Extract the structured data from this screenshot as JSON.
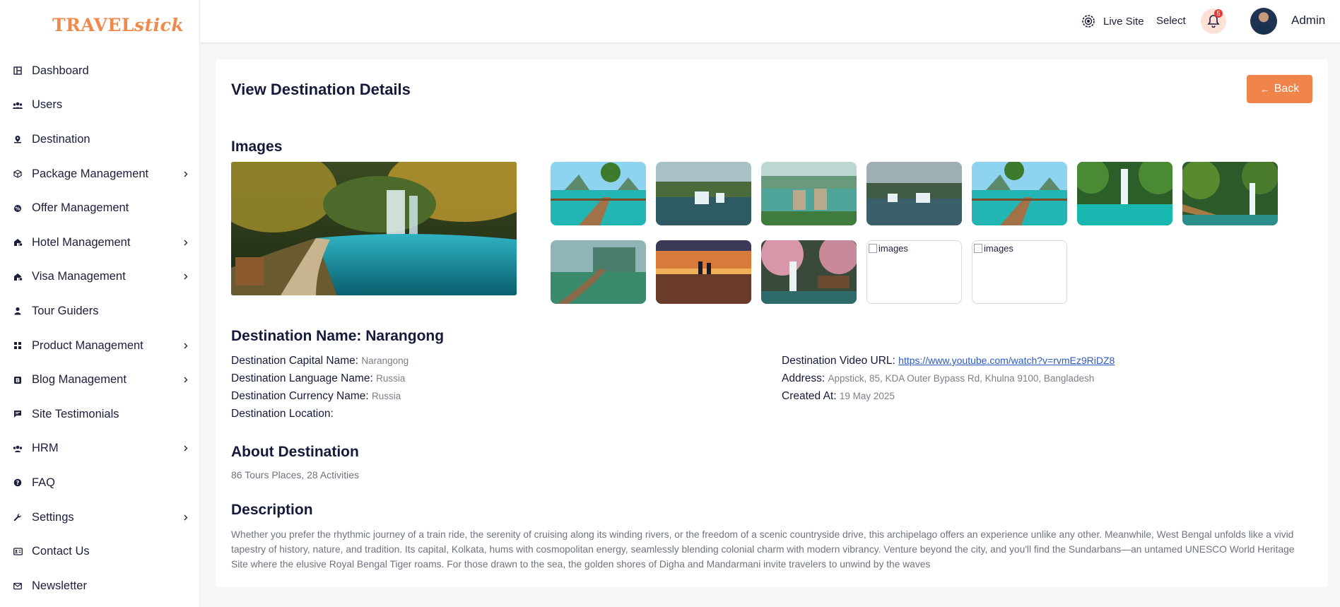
{
  "brand": {
    "logo_text_a": "TRAVEL",
    "logo_text_b": "stick",
    "color": "#f08a4b"
  },
  "sidebar": {
    "items": [
      {
        "label": "Dashboard",
        "icon": "dashboard-icon",
        "has_submenu": false
      },
      {
        "label": "Users",
        "icon": "users-icon",
        "has_submenu": false
      },
      {
        "label": "Destination",
        "icon": "location-pin-icon",
        "has_submenu": false
      },
      {
        "label": "Package Management",
        "icon": "package-icon",
        "has_submenu": true
      },
      {
        "label": "Offer Management",
        "icon": "offer-icon",
        "has_submenu": false
      },
      {
        "label": "Hotel Management",
        "icon": "hotel-icon",
        "has_submenu": true
      },
      {
        "label": "Visa Management",
        "icon": "visa-icon",
        "has_submenu": true
      },
      {
        "label": "Tour Guiders",
        "icon": "person-icon",
        "has_submenu": false
      },
      {
        "label": "Product Management",
        "icon": "grid-icon",
        "has_submenu": true
      },
      {
        "label": "Blog Management",
        "icon": "blog-icon",
        "has_submenu": true
      },
      {
        "label": "Site Testimonials",
        "icon": "chat-icon",
        "has_submenu": false
      },
      {
        "label": "HRM",
        "icon": "team-icon",
        "has_submenu": true
      },
      {
        "label": "FAQ",
        "icon": "question-icon",
        "has_submenu": false
      },
      {
        "label": "Settings",
        "icon": "wrench-icon",
        "has_submenu": true
      },
      {
        "label": "Contact Us",
        "icon": "contact-card-icon",
        "has_submenu": false
      },
      {
        "label": "Newsletter",
        "icon": "mail-icon",
        "has_submenu": false
      }
    ]
  },
  "header": {
    "live_site": "Live Site",
    "select": "Select",
    "notification_count": "5",
    "user_name": "Admin"
  },
  "page": {
    "title": "View Destination Details",
    "back_label": "Back",
    "images_title": "Images",
    "broken_image_alt": "images",
    "destination_name_label": "Destination Name:",
    "destination_name": "Narangong",
    "fields_left": [
      {
        "label": "Destination Capital Name:",
        "value": "Narangong"
      },
      {
        "label": "Destination Language Name:",
        "value": "Russia"
      },
      {
        "label": "Destination Currency Name:",
        "value": "Russia"
      },
      {
        "label": "Destination Location:",
        "value": ""
      }
    ],
    "video_url_label": "Destination Video URL:",
    "video_url": "https://www.youtube.com/watch?v=rvmEz9RiDZ8",
    "address_label": "Address:",
    "address": "Appstick, 85, KDA Outer Bypass Rd, Khulna 9100, Bangladesh",
    "created_at_label": "Created At:",
    "created_at": "19 May 2025",
    "about_title": "About Destination",
    "about_text": "86 Tours Places, 28 Activities",
    "description_title": "Description",
    "description": "Whether you prefer the rhythmic journey of a train ride, the serenity of cruising along its winding rivers, or the freedom of a scenic countryside drive, this archipelago offers an experience unlike any other. Meanwhile, West Bengal unfolds like a vivid tapestry of history, nature, and tradition. Its capital, Kolkata, hums with cosmopolitan energy, seamlessly blending colonial charm with modern vibrancy. Venture beyond the city, and you'll find the Sundarbans—an untamed UNESCO World Heritage Site where the elusive Royal Bengal Tiger roams. For those drawn to the sea, the golden shores of Digha and Mandarmani invite travelers to unwind by the waves"
  }
}
